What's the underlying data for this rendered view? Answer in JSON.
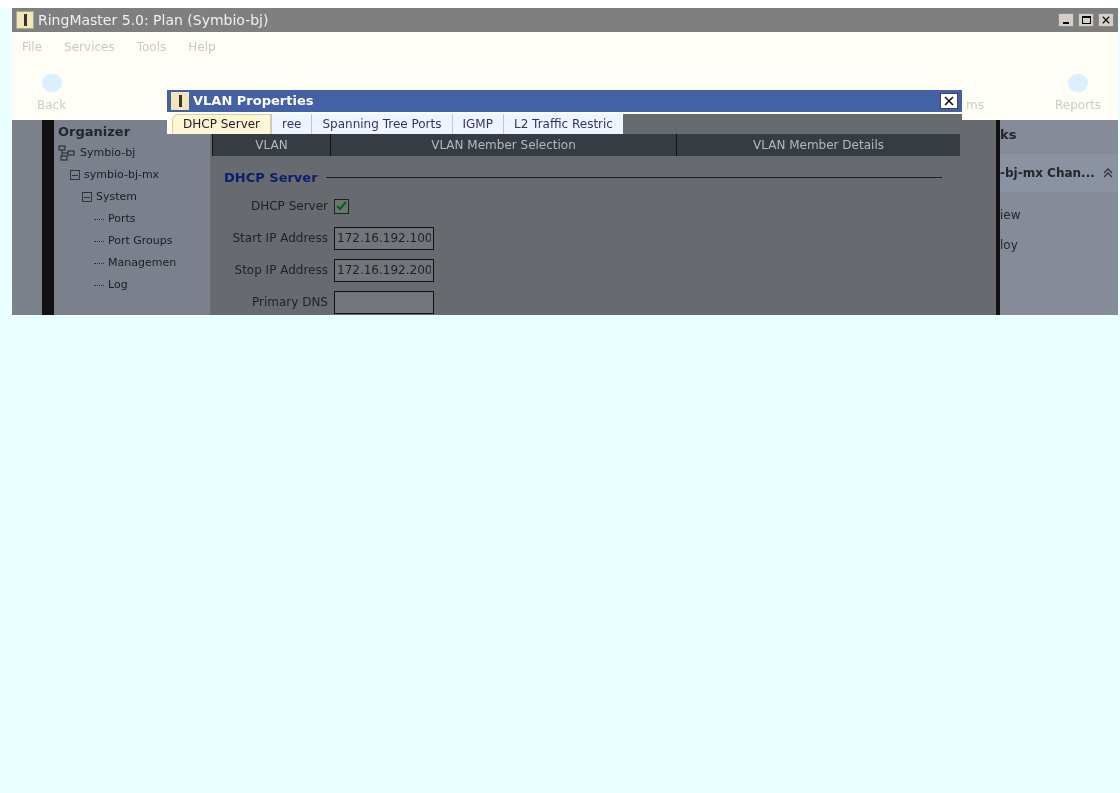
{
  "window": {
    "title": "RingMaster 5.0: Plan (Symbio-bj)"
  },
  "menu": [
    "File",
    "Services",
    "Tools",
    "Help"
  ],
  "toolbar": [
    "Back",
    "ms",
    "Reports"
  ],
  "organizer": {
    "title": "Organizer",
    "tree": [
      {
        "label": "Symbio-bj",
        "kind": "root",
        "children": [
          {
            "label": "symbio-bj-mx",
            "expanded": true,
            "children": [
              {
                "label": "System",
                "expanded": true,
                "children": [
                  {
                    "label": "Ports"
                  },
                  {
                    "label": "Port Groups"
                  },
                  {
                    "label": "Managemen"
                  },
                  {
                    "label": "Log"
                  }
                ]
              }
            ]
          }
        ]
      }
    ]
  },
  "dialog": {
    "title": "VLAN Properties",
    "tabs": [
      {
        "label": "DHCP Server",
        "selected": true
      },
      {
        "label": "ree",
        "selected": false
      },
      {
        "label": "Spanning Tree Ports",
        "selected": false
      },
      {
        "label": "IGMP",
        "selected": false
      },
      {
        "label": "L2 Traffic Restric",
        "selected": false
      }
    ],
    "steps": [
      "VLAN",
      "VLAN Member Selection",
      "VLAN Member Details"
    ],
    "section": "DHCP Server",
    "fields": [
      {
        "kind": "checkbox",
        "label": "DHCP Server",
        "checked": true
      },
      {
        "kind": "text",
        "label": "Start IP Address",
        "value": "172.16.192.100"
      },
      {
        "kind": "text",
        "label": "Stop IP Address",
        "value": "172.16.192.200"
      },
      {
        "kind": "text",
        "label": "Primary DNS"
      }
    ]
  },
  "tasks": {
    "title": "ks",
    "section": "-bj-mx Chan...",
    "items": [
      "iew",
      "loy"
    ]
  }
}
